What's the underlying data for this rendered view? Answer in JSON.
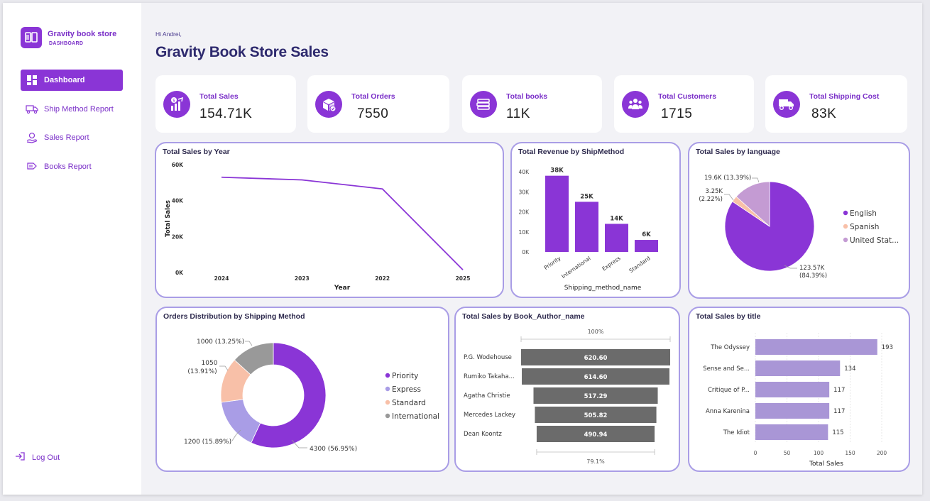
{
  "brand": {
    "title": "Gravity book store",
    "subtitle": "DASHBOARD"
  },
  "nav": [
    {
      "label": "Dashboard",
      "icon": "dashboard-icon",
      "active": true
    },
    {
      "label": "Ship Method Report",
      "icon": "truck-icon",
      "active": false
    },
    {
      "label": "Sales Report",
      "icon": "hand-money-icon",
      "active": false
    },
    {
      "label": "Books Report",
      "icon": "books-icon",
      "active": false
    }
  ],
  "logout": "Log Out",
  "greeting": "Hi Andrei,",
  "page_title": "Gravity Book Store Sales",
  "kpis": [
    {
      "label": "Total Sales",
      "value": "154.71K",
      "icon": "sales-chart-icon"
    },
    {
      "label": "Total Orders",
      "value": "7550",
      "icon": "orders-box-icon"
    },
    {
      "label": "Total books",
      "value": "11K",
      "icon": "books-stack-icon"
    },
    {
      "label": "Total Customers",
      "value": "1715",
      "icon": "customers-icon"
    },
    {
      "label": "Total Shipping Cost",
      "value": "83K",
      "icon": "shipping-truck-icon"
    }
  ],
  "colors": {
    "accent": "#8a35d6",
    "light_purple": "#a99de6",
    "peach": "#f8c0a8",
    "gray": "#999999",
    "funnel": "#6b6b6b",
    "bar_light": "#a996d6"
  },
  "chart_data": [
    {
      "type": "line",
      "title": "Total Sales by Year",
      "xlabel": "Year",
      "ylabel": "Total Sales",
      "categories": [
        "2024",
        "2023",
        "2022",
        "2025"
      ],
      "values": [
        53000,
        51500,
        46500,
        1500
      ],
      "y_ticks": [
        "0K",
        "20K",
        "40K",
        "60K"
      ],
      "ylim": [
        0,
        60000
      ]
    },
    {
      "type": "bar",
      "title": "Total Revenue by ShipMethod",
      "xlabel": "Shipping_method_name",
      "categories": [
        "Priority",
        "International",
        "Express",
        "Standard"
      ],
      "values": [
        38000,
        25000,
        14000,
        6000
      ],
      "data_labels": [
        "38K",
        "25K",
        "14K",
        "6K"
      ],
      "y_ticks": [
        "0K",
        "10K",
        "20K",
        "30K",
        "40K"
      ],
      "ylim": [
        0,
        40000
      ]
    },
    {
      "type": "pie",
      "title": "Total Sales by language",
      "categories": [
        "English",
        "Spanish",
        "United Stat..."
      ],
      "values": [
        123570,
        3250,
        19600
      ],
      "percents": [
        84.39,
        2.22,
        13.39
      ],
      "labels": [
        "123.57K\n(84.39%)",
        "3.25K\n(2.22%)",
        "19.6K (13.39%)"
      ],
      "colors": [
        "#8a35d6",
        "#f8c0a8",
        "#c49bd3"
      ]
    },
    {
      "type": "pie",
      "title": "Orders Distribution by Shipping Method",
      "categories": [
        "Priority",
        "Express",
        "Standard",
        "International"
      ],
      "values": [
        4300,
        1200,
        1050,
        1000
      ],
      "percents": [
        56.95,
        15.89,
        13.91,
        13.25
      ],
      "labels": [
        "4300 (56.95%)",
        "1200 (15.89%)",
        "1050\n(13.91%)",
        "1000 (13.25%)"
      ],
      "colors": [
        "#8a35d6",
        "#a99de6",
        "#f8c0a8",
        "#999999"
      ]
    },
    {
      "type": "bar",
      "subtype": "funnel",
      "title": "Total Sales by Book_Author_name",
      "categories": [
        "P.G. Wodehouse",
        "Rumiko Takaha...",
        "Agatha Christie",
        "Mercedes Lackey",
        "Dean Koontz"
      ],
      "values": [
        620.6,
        614.6,
        517.29,
        505.82,
        490.94
      ],
      "data_labels": [
        "620.60",
        "614.60",
        "517.29",
        "505.82",
        "490.94"
      ],
      "top_percent": "100%",
      "bottom_percent": "79.1%"
    },
    {
      "type": "bar",
      "orientation": "horizontal",
      "title": "Total Sales by title",
      "xlabel": "Total Sales",
      "categories": [
        "The Odyssey",
        "Sense and Se...",
        "Critique of P...",
        "Anna Karenina",
        "The Idiot"
      ],
      "values": [
        193,
        134,
        117,
        117,
        115
      ],
      "x_ticks": [
        "0",
        "50",
        "100",
        "150",
        "200"
      ],
      "xlim": [
        0,
        200
      ]
    }
  ]
}
